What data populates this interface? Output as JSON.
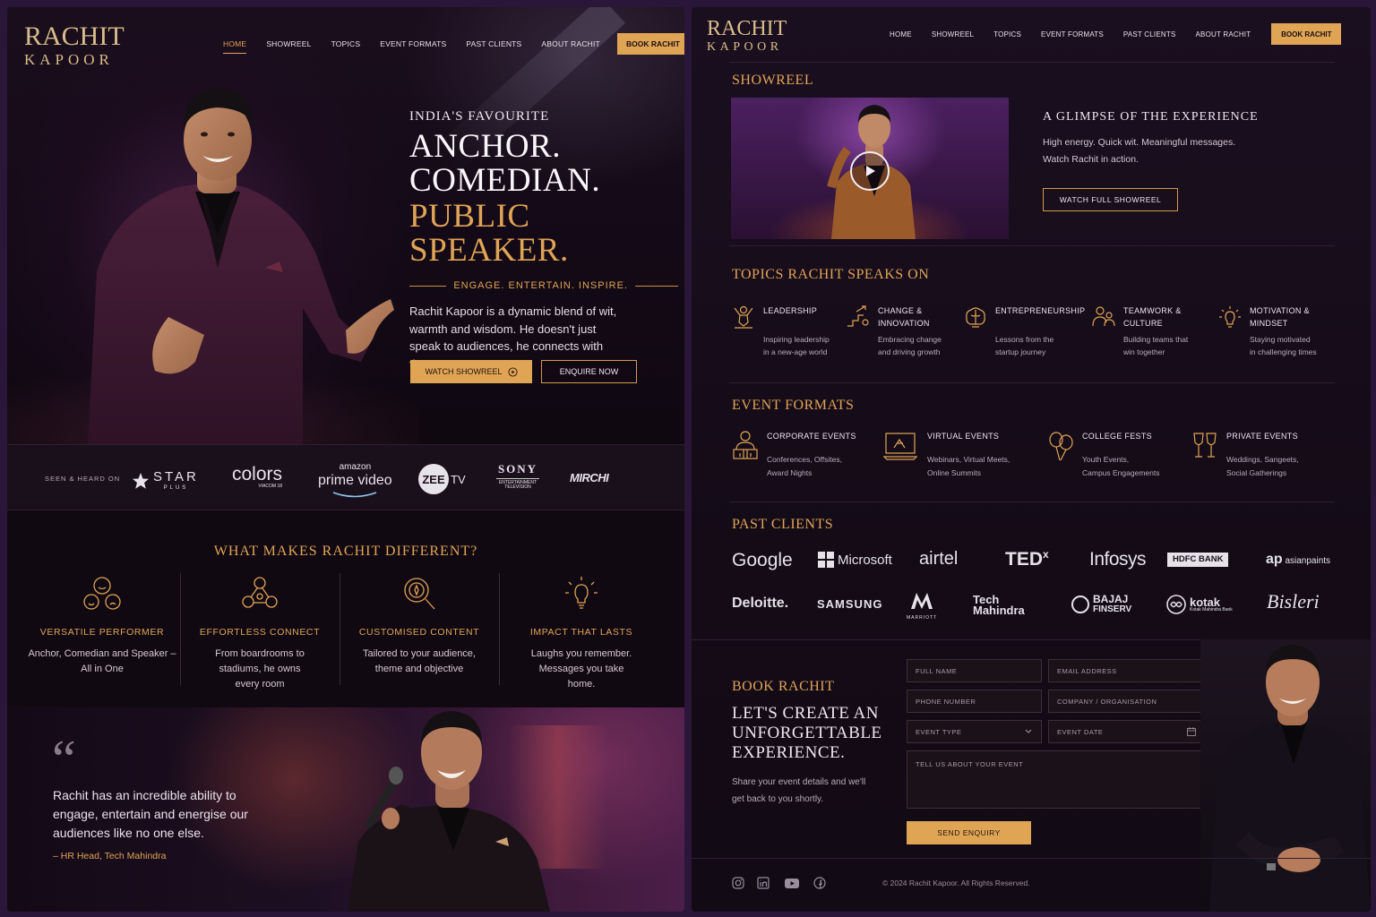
{
  "brand": {
    "line1": "RACHIT",
    "line2": "KAPOOR"
  },
  "nav": {
    "items": [
      "HOME",
      "SHOWREEL",
      "TOPICS",
      "EVENT FORMATS",
      "PAST CLIENTS",
      "ABOUT RACHIT"
    ],
    "cta": "BOOK RACHIT"
  },
  "hero": {
    "eyebrow": "INDIA'S FAVOURITE",
    "line1": "ANCHOR.",
    "line2": "COMEDIAN.",
    "line3": "PUBLIC SPEAKER.",
    "tagline": "ENGAGE. ENTERTAIN. INSPIRE.",
    "intro": "Rachit Kapoor is a dynamic blend of wit, warmth and wisdom. He doesn't just speak to audiences, he connects with them.",
    "btn_showreel": "WATCH SHOWREEL",
    "btn_enquire": "ENQUIRE NOW"
  },
  "seen": {
    "label": "SEEN & HEARD ON",
    "logos": {
      "star": "STAR",
      "star_sub": "PLUS",
      "colors": "colors",
      "colors_sub": "VIACOM 18",
      "amazon": "amazon",
      "prime": "prime video",
      "zee": "ZEE",
      "zee_tv": "TV",
      "sony": "SONY",
      "sony_sub": "ENTERTAINMENT TELEVISION",
      "mirchi": "MIRCHI"
    }
  },
  "different": {
    "title": "WHAT MAKES RACHIT DIFFERENT?",
    "features": [
      {
        "title": "VERSATILE PERFORMER",
        "desc": "Anchor, Comedian and Speaker – All in One"
      },
      {
        "title": "EFFORTLESS CONNECT",
        "desc": "From boardrooms to stadiums, he owns every room"
      },
      {
        "title": "CUSTOMISED CONTENT",
        "desc": "Tailored to your audience, theme and objective"
      },
      {
        "title": "IMPACT THAT LASTS",
        "desc": "Laughs you remember. Messages you take home."
      }
    ]
  },
  "quote": {
    "mark": "“",
    "text": "Rachit has an incredible ability to engage, entertain and energise our audiences like no one else.",
    "author": "– HR Head, Tech Mahindra"
  },
  "showreel": {
    "title": "SHOWREEL",
    "heading": "A GLIMPSE OF THE EXPERIENCE",
    "desc1": "High energy. Quick wit. Meaningful messages.",
    "desc2": "Watch Rachit in action.",
    "btn": "WATCH FULL SHOWREEL"
  },
  "topics": {
    "title": "TOPICS RACHIT SPEAKS ON",
    "items": [
      {
        "title1": "LEADERSHIP",
        "title2": "",
        "desc1": "Inspiring leadership",
        "desc2": "in a new-age world"
      },
      {
        "title1": "CHANGE &",
        "title2": "INNOVATION",
        "desc1": "Embracing change",
        "desc2": "and driving growth"
      },
      {
        "title1": "ENTREPRENEURSHIP",
        "title2": "",
        "desc1": "Lessons from the",
        "desc2": "startup journey"
      },
      {
        "title1": "TEAMWORK &",
        "title2": "CULTURE",
        "desc1": "Building teams that",
        "desc2": "win together"
      },
      {
        "title1": "MOTIVATION &",
        "title2": "MINDSET",
        "desc1": "Staying motivated",
        "desc2": "in challenging times"
      }
    ]
  },
  "formats": {
    "title": "EVENT FORMATS",
    "items": [
      {
        "title": "CORPORATE EVENTS",
        "desc1": "Conferences, Offsites,",
        "desc2": "Award Nights"
      },
      {
        "title": "VIRTUAL EVENTS",
        "desc1": "Webinars, Virtual Meets,",
        "desc2": "Online Summits"
      },
      {
        "title": "COLLEGE FESTS",
        "desc1": "Youth Events,",
        "desc2": "Campus Engagements"
      },
      {
        "title": "PRIVATE EVENTS",
        "desc1": "Weddings, Sangeets,",
        "desc2": "Social Gatherings"
      }
    ]
  },
  "clients": {
    "title": "PAST CLIENTS",
    "names": {
      "google": "Google",
      "microsoft": "Microsoft",
      "airtel": "airtel",
      "ted": "TED",
      "ted_x": "x",
      "infosys": "Infosys",
      "hdfc": "HDFC BANK",
      "asianpaints": "asianpaints",
      "deloitte": "Deloitte.",
      "samsung": "SAMSUNG",
      "marriott": "MARRIOTT",
      "tech1": "Tech",
      "tech2": "Mahindra",
      "bajaj1": "BAJAJ",
      "bajaj2": "FINSERV",
      "kotak": "kotak",
      "kotak_sub": "Kotak Mahindra Bank",
      "bisleri": "Bisleri"
    }
  },
  "booking": {
    "title": "BOOK RACHIT",
    "heading1": "LET'S CREATE AN",
    "heading2": "UNFORGETTABLE",
    "heading3": "EXPERIENCE.",
    "desc1": "Share your event details and we'll",
    "desc2": "get back to you shortly.",
    "fields": {
      "name": "FULL NAME",
      "email": "EMAIL ADDRESS",
      "phone": "PHONE NUMBER",
      "company": "COMPANY / ORGANISATION",
      "event_type": "EVENT TYPE",
      "event_date": "EVENT DATE",
      "message": "TELL US ABOUT YOUR EVENT"
    },
    "submit": "SEND ENQUIRY"
  },
  "footer": {
    "copyright": "© 2024 Rachit Kapoor. All Rights Reserved.",
    "icons": [
      "instagram-icon",
      "linkedin-icon",
      "youtube-icon",
      "facebook-icon"
    ]
  },
  "colors": {
    "accent": "#e0a455",
    "bg": "#0f0810",
    "text": "#e8dfe9"
  }
}
